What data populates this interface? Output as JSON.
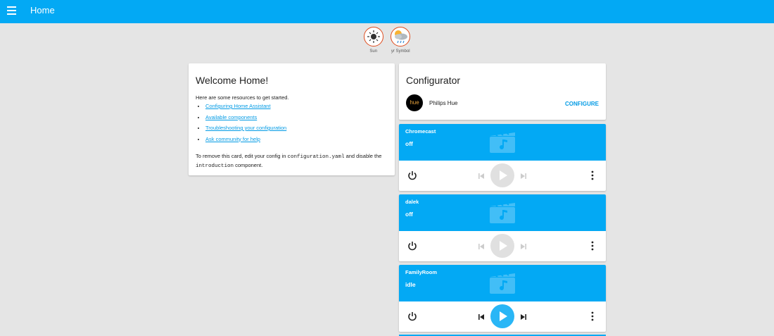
{
  "toolbar": {
    "title": "Home"
  },
  "badges": [
    {
      "label": "Sun",
      "icon": "sun-icon"
    },
    {
      "label": "yr Symbol",
      "icon": "weather-rain-icon"
    }
  ],
  "welcome": {
    "title": "Welcome Home!",
    "intro": "Here are some resources to get started.",
    "links": [
      "Configuring Home Assistant",
      "Available components",
      "Troubleshooting your configuration",
      "Ask community for help"
    ],
    "outro_1": "To remove this card, edit your config in ",
    "outro_code_1": "configuration.yaml",
    "outro_2": " and disable the ",
    "outro_code_2": "introduction",
    "outro_3": " component."
  },
  "configurator": {
    "title": "Configurator",
    "logo_text": "hue",
    "entity_name": "Philips Hue",
    "configure_label": "CONFIGURE"
  },
  "media_players": [
    {
      "name": "Chromecast",
      "state": "off",
      "active": false
    },
    {
      "name": "dalek",
      "state": "off",
      "active": false
    },
    {
      "name": "FamilyRoom",
      "state": "idle",
      "active": true
    }
  ],
  "colors": {
    "primary": "#03a9f4",
    "background": "#e5e5e5",
    "badge_border": "#df4c1e"
  }
}
